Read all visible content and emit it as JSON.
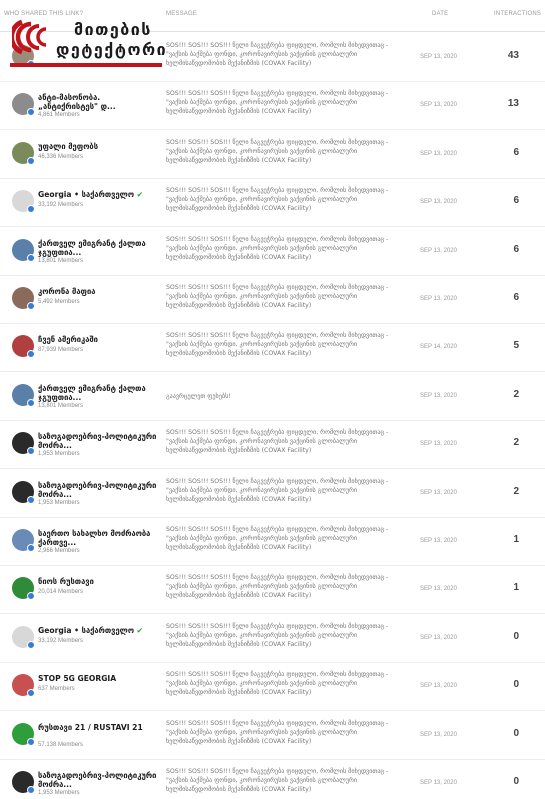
{
  "header": {
    "who_label": "Who shared this link?",
    "message_label": "Message",
    "date_label": "Date",
    "interactions_label": "Interactions"
  },
  "logo": {
    "line1": "მითების",
    "line2": "დეტექტორი",
    "brand_color": "#c0141c"
  },
  "rows": [
    {
      "name": "",
      "members": "",
      "message": "SOS!!! SOS!!! SOS!!! წელი ჩაგვეჭრება ფიცდელი, რომლის მიხედვითაც - \"ვაქსის ბაქშება ფონდი, კორონავირუსის ვაქცინის გლობალური ხელმისაწვდომობის მექანიზმის (COVAX Facility)",
      "date": "SEP 13, 2020",
      "interactions": "43",
      "avatar_color": "#9c8a7a"
    },
    {
      "name": "ანტი-მასონობა. „ანტიქრისტეს\" დ...",
      "members": "4,861 Members",
      "message": "SOS!!! SOS!!! SOS!!! წელი ჩაგვეჭრება ფიცდელი, რომლის მიხედვითაც - \"ვაქსის ბაქშება ფონდი, კორონავირუსის ვაქცინის გლობალური ხელმისაწვდომობის მექანიზმის (COVAX Facility)",
      "date": "SEP 13, 2020",
      "interactions": "13",
      "avatar_color": "#8c8c8c"
    },
    {
      "name": "უფალი მეფობს",
      "members": "46,336 Members",
      "message": "SOS!!! SOS!!! SOS!!! წელი ჩაგვეჭრება ფიცდელი, რომლის მიხედვითაც - \"ვაქსის ბაქშება ფონდი, კორონავირუსის ვაქცინის გლობალური ხელმისაწვდომობის მექანიზმის (COVAX Facility)",
      "date": "SEP 13, 2020",
      "interactions": "6",
      "avatar_color": "#7a8a5a"
    },
    {
      "name": "Georgia • საქართველო",
      "members": "33,192 Members",
      "message": "SOS!!! SOS!!! SOS!!! წელი ჩაგვეჭრება ფიცდელი, რომლის მიხედვითაც - \"ვაქსის ბაქშება ფონდი, კორონავირუსის ვაქცინის გლობალური ხელმისაწვდომობის მექანიზმის (COVAX Facility)",
      "date": "SEP 13, 2020",
      "interactions": "6",
      "avatar_color": "#d8d8d8",
      "verified": "✔"
    },
    {
      "name": "ქართველ ემიგრანტ ქალთა ჯგუფთია...",
      "members": "13,801 Members",
      "message": "SOS!!! SOS!!! SOS!!! წელი ჩაგვეჭრება ფიცდელი, რომლის მიხედვითაც - \"ვაქსის ბაქშება ფონდი, კორონავირუსის ვაქცინის გლობალური ხელმისაწვდომობის მექანიზმის (COVAX Facility)",
      "date": "SEP 13, 2020",
      "interactions": "6",
      "avatar_color": "#5a7fa8"
    },
    {
      "name": "კორონა მაფია",
      "members": "5,492 Members",
      "message": "SOS!!! SOS!!! SOS!!! წელი ჩაგვეჭრება ფიცდელი, რომლის მიხედვითაც - \"ვაქსის ბაქშება ფონდი, კორონავირუსის ვაქცინის გლობალური ხელმისაწვდომობის მექანიზმის (COVAX Facility)",
      "date": "SEP 13, 2020",
      "interactions": "6",
      "avatar_color": "#8a6a5a"
    },
    {
      "name": "ჩვენ ამერიკაში",
      "members": "87,939 Members",
      "message": "SOS!!! SOS!!! SOS!!! წელი ჩაგვეჭრება ფიცდელი, რომლის მიხედვითაც - \"ვაქსის ბაქშება ფონდი, კორონავირუსის ვაქცინის გლობალური ხელმისაწვდომობის მექანიზმის (COVAX Facility)",
      "date": "SEP 14, 2020",
      "interactions": "5",
      "avatar_color": "#b04040"
    },
    {
      "name": "ქართველ ემიგრანტ ქალთა ჯგუფთია...",
      "members": "13,801 Members",
      "message": "გაავრცელეთ ფეხებს!",
      "date": "SEP 13, 2020",
      "interactions": "2",
      "avatar_color": "#5a7fa8"
    },
    {
      "name": "საზოგადოებრივ-პოლიტიკური მოძრა...",
      "members": "1,953 Members",
      "message": "SOS!!! SOS!!! SOS!!! წელი ჩაგვეჭრება ფიცდელი, რომლის მიხედვითაც - \"ვაქსის ბაქშება ფონდი, კორონავირუსის ვაქცინის გლობალური ხელმისაწვდომობის მექანიზმის (COVAX Facility)",
      "date": "SEP 13, 2020",
      "interactions": "2",
      "avatar_color": "#2a2a2a"
    },
    {
      "name": "საზოგადოებრივ-პოლიტიკური მოძრა...",
      "members": "1,953 Members",
      "message": "SOS!!! SOS!!! SOS!!! წელი ჩაგვეჭრება ფიცდელი, რომლის მიხედვითაც - \"ვაქსის ბაქშება ფონდი, კორონავირუსის ვაქცინის გლობალური ხელმისაწვდომობის მექანიზმის (COVAX Facility)",
      "date": "SEP 13, 2020",
      "interactions": "2",
      "avatar_color": "#2a2a2a"
    },
    {
      "name": "საერთო სახალხო მოძრაობა ქართვე...",
      "members": "2,966 Members",
      "message": "SOS!!! SOS!!! SOS!!! წელი ჩაგვეჭრება ფიცდელი, რომლის მიხედვითაც - \"ვაქსის ბაქშება ფონდი, კორონავირუსის ვაქცინის გლობალური ხელმისაწვდომობის მექანიზმის (COVAX Facility)",
      "date": "SEP 13, 2020",
      "interactions": "1",
      "avatar_color": "#6a8ab8"
    },
    {
      "name": "ნიოს რუსთავი",
      "members": "20,014 Members",
      "message": "SOS!!! SOS!!! SOS!!! წელი ჩაგვეჭრება ფიცდელი, რომლის მიხედვითაც - \"ვაქსის ბაქშება ფონდი, კორონავირუსის ვაქცინის გლობალური ხელმისაწვდომობის მექანიზმის (COVAX Facility)",
      "date": "SEP 13, 2020",
      "interactions": "1",
      "avatar_color": "#2e8b3a"
    },
    {
      "name": "Georgia • საქართველო",
      "members": "33,192 Members",
      "message": "SOS!!! SOS!!! SOS!!! წელი ჩაგვეჭრება ფიცდელი, რომლის მიხედვითაც - \"ვაქსის ბაქშება ფონდი, კორონავირუსის ვაქცინის გლობალური ხელმისაწვდომობის მექანიზმის (COVAX Facility)",
      "date": "SEP 13, 2020",
      "interactions": "0",
      "avatar_color": "#d8d8d8",
      "verified": "✔"
    },
    {
      "name": "STOP 5G GEORGIA",
      "members": "637 Members",
      "message": "SOS!!! SOS!!! SOS!!! წელი ჩაგვეჭრება ფიცდელი, რომლის მიხედვითაც - \"ვაქსის ბაქშება ფონდი, კორონავირუსის ვაქცინის გლობალური ხელმისაწვდომობის მექანიზმის (COVAX Facility)",
      "date": "SEP 13, 2020",
      "interactions": "0",
      "avatar_color": "#c85050"
    },
    {
      "name": "რუსთავი 21 / RUSTAVI 21",
      "members": "57,138 Members",
      "message": "SOS!!! SOS!!! SOS!!! წელი ჩაგვეჭრება ფიცდელი, რომლის მიხედვითაც - \"ვაქსის ბაქშება ფონდი, კორონავირუსის ვაქცინის გლობალური ხელმისაწვდომობის მექანიზმის (COVAX Facility)",
      "date": "SEP 13, 2020",
      "interactions": "0",
      "avatar_color": "#2e9e3a"
    },
    {
      "name": "საზოგადოებრივ-პოლიტიკური მოძრა...",
      "members": "1,953 Members",
      "message": "SOS!!! SOS!!! SOS!!! წელი ჩაგვეჭრება ფიცდელი, რომლის მიხედვითაც - \"ვაქსის ბაქშება ფონდი, კორონავირუსის ვაქცინის გლობალური ხელმისაწვდომობის მექანიზმის (COVAX Facility)",
      "date": "SEP 13, 2020",
      "interactions": "0",
      "avatar_color": "#2a2a2a"
    }
  ]
}
